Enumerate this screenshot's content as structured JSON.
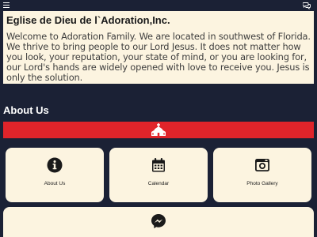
{
  "header": {
    "menu_icon": "hamburger-menu-icon",
    "chat_icon": "chat-bubbles-icon"
  },
  "welcome": {
    "title": "Eglise de Dieu de l`Adoration,Inc.",
    "body": "Welcome to Adoration Family. We are located in southwest of Florida. We thrive to bring people to our Lord Jesus. It does not matter how you look, your reputation, your state of mind, or you are looking for, our Lord's hands are widely opened with love to receive you. Jesus is only the solution."
  },
  "about": {
    "title": "About Us",
    "banner_icon": "church-icon",
    "banner_color": "#e0242a"
  },
  "cards": [
    {
      "label": "About Us",
      "icon": "info-icon"
    },
    {
      "label": "Calendar",
      "icon": "calendar-icon"
    },
    {
      "label": "Photo Gallery",
      "icon": "camera-icon"
    }
  ],
  "bottom": {
    "icon": "messenger-icon"
  },
  "colors": {
    "background": "#1b2135",
    "card": "#fcf4e0",
    "accent": "#e0242a"
  }
}
